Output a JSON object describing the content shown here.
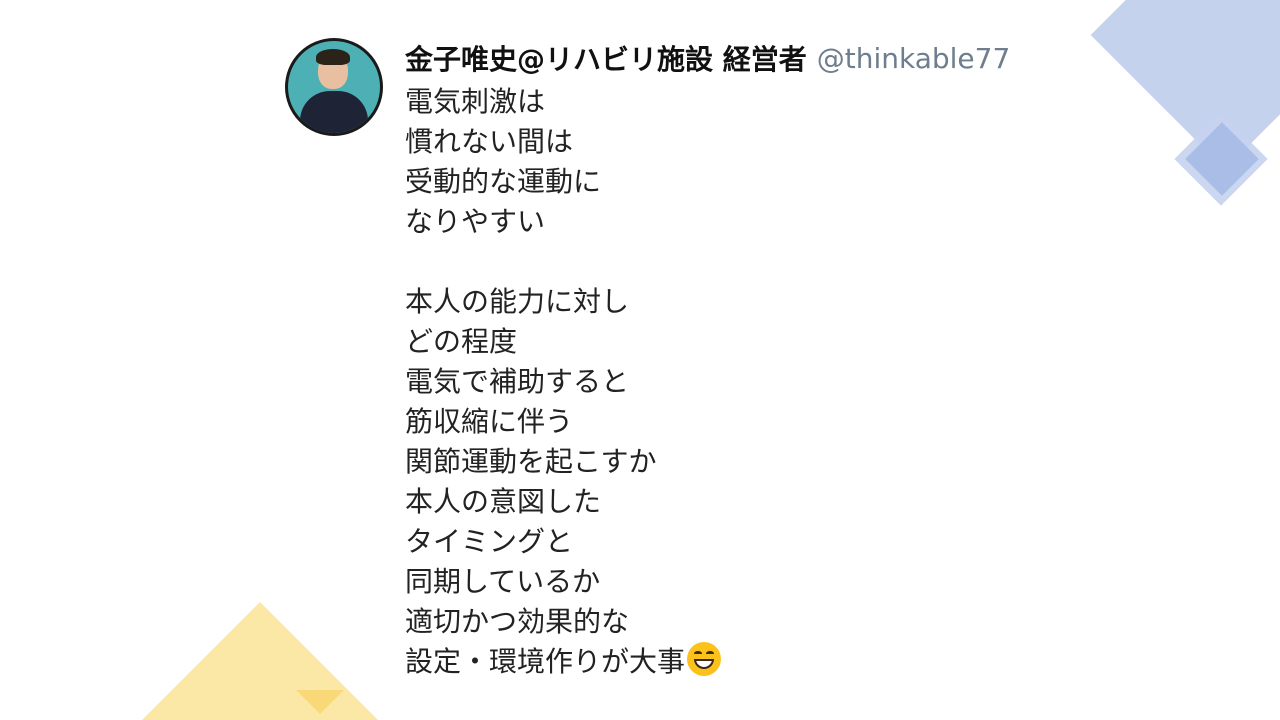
{
  "tweet": {
    "display_name": "金子唯史@リハビリ施設 経営者",
    "handle": "@thinkable77",
    "lines": [
      "電気刺激は",
      "慣れない間は",
      "受動的な運動に",
      "なりやすい",
      "",
      "本人の能力に対し",
      "どの程度",
      "電気で補助すると",
      "筋収縮に伴う",
      "関節運動を起こすか",
      "本人の意図した",
      "タイミングと",
      "同期しているか",
      "適切かつ効果的な",
      "設定・環境作りが大事"
    ],
    "trailing_emoji": "grinning-face-emoji"
  },
  "colors": {
    "accent_blue": "#c5d2ee",
    "accent_yellow": "#fce8a6",
    "handle_gray": "#6e7e8e",
    "avatar_bg": "#4db0b4"
  }
}
